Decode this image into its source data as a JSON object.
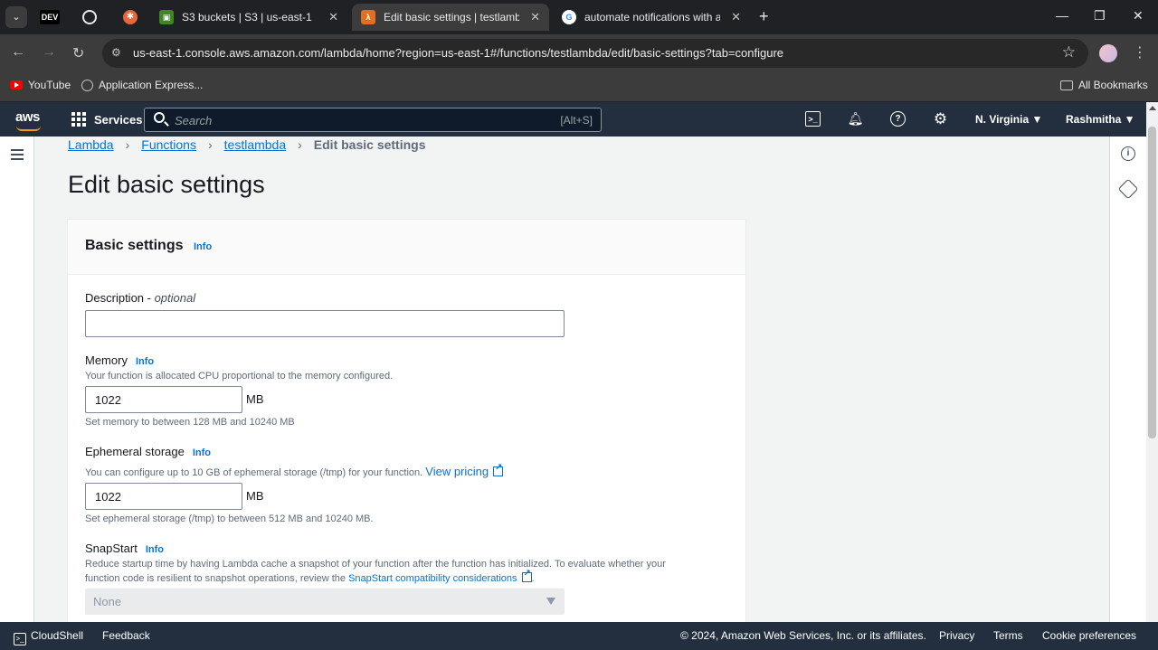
{
  "browser": {
    "pinned": [
      "DEV"
    ],
    "tabs": [
      {
        "title": "S3 buckets | S3 | us-east-1",
        "favicon_color": "#3f8624"
      },
      {
        "title": "Edit basic settings | testlambda",
        "favicon_color": "#e07020",
        "active": true
      },
      {
        "title": "automate notifications with am",
        "favicon_color": "#4285f4"
      }
    ],
    "url": "us-east-1.console.aws.amazon.com/lambda/home?region=us-east-1#/functions/testlambda/edit/basic-settings?tab=configure",
    "bookmarks": [
      {
        "label": "YouTube",
        "icon": "youtube-icon"
      },
      {
        "label": "Application Express...",
        "icon": "globe-icon"
      }
    ],
    "all_bookmarks": "All Bookmarks"
  },
  "aws": {
    "logo": "aws",
    "services": "Services",
    "search_placeholder": "Search",
    "search_shortcut": "[Alt+S]",
    "region": "N. Virginia ▼",
    "user": "Rashmitha ▼"
  },
  "breadcrumb": [
    "Lambda",
    "Functions",
    "testlambda",
    "Edit basic settings"
  ],
  "page_title": "Edit basic settings",
  "panel": {
    "title": "Basic settings",
    "info": "Info",
    "description": {
      "label": "Description - ",
      "optional": "optional",
      "value": ""
    },
    "memory": {
      "label": "Memory",
      "help": "Your function is allocated CPU proportional to the memory configured.",
      "value": "1022",
      "unit": "MB",
      "constraint": "Set memory to between 128 MB and 10240 MB"
    },
    "ephemeral": {
      "label": "Ephemeral storage",
      "help": "You can configure up to 10 GB of ephemeral storage (/tmp) for your function.",
      "link": "View pricing",
      "value": "1022",
      "unit": "MB",
      "constraint": "Set ephemeral storage (/tmp) to between 512 MB and 10240 MB."
    },
    "snapstart": {
      "label": "SnapStart",
      "help1": "Reduce startup time by having Lambda cache a snapshot of your function after the function has initialized. To evaluate whether your",
      "help2": "function code is resilient to snapshot operations, review the ",
      "link": "SnapStart compatibility considerations",
      "help3": ".",
      "selected": "None"
    }
  },
  "footer": {
    "cloudshell": "CloudShell",
    "feedback": "Feedback",
    "copyright": "© 2024, Amazon Web Services, Inc. or its affiliates.",
    "privacy": "Privacy",
    "terms": "Terms",
    "cookies": "Cookie preferences"
  }
}
